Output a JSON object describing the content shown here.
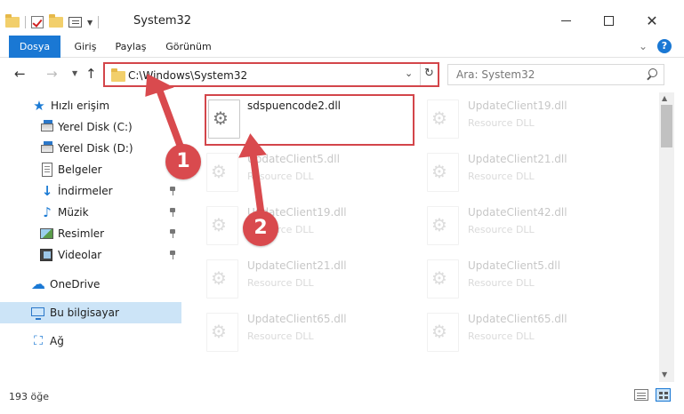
{
  "window": {
    "title": "System32"
  },
  "ribbon": {
    "tabs": [
      "Dosya",
      "Giriş",
      "Paylaş",
      "Görünüm"
    ],
    "help": "?"
  },
  "address": {
    "path": "C:\\Windows\\System32"
  },
  "search": {
    "placeholder": "Ara: System32"
  },
  "sidebar": {
    "items": [
      {
        "label": "Hızlı erişim",
        "icon": "quick-access-star-icon"
      },
      {
        "label": "Yerel Disk (C:)",
        "icon": "drive-icon"
      },
      {
        "label": "Yerel Disk (D:)",
        "icon": "drive-icon"
      },
      {
        "label": "Belgeler",
        "icon": "documents-icon",
        "pinned": true
      },
      {
        "label": "İndirmeler",
        "icon": "downloads-icon",
        "pinned": true
      },
      {
        "label": "Müzik",
        "icon": "music-icon",
        "pinned": true
      },
      {
        "label": "Resimler",
        "icon": "pictures-icon",
        "pinned": true
      },
      {
        "label": "Videolar",
        "icon": "videos-icon",
        "pinned": true
      },
      {
        "label": "OneDrive",
        "icon": "onedrive-icon"
      },
      {
        "label": "Bu bilgisayar",
        "icon": "this-pc-icon",
        "selected": true
      },
      {
        "label": "Ağ",
        "icon": "network-icon"
      }
    ]
  },
  "files": [
    {
      "name": "sdspuencode2.dll",
      "type": "",
      "highlighted": true
    },
    {
      "name": "UpdateClient19.dll",
      "type": "Resource DLL"
    },
    {
      "name": "UpdateClient5.dll",
      "type": "Resource DLL"
    },
    {
      "name": "UpdateClient21.dll",
      "type": "Resource DLL"
    },
    {
      "name": "UpdateClient19.dll",
      "type": "Resource DLL"
    },
    {
      "name": "UpdateClient42.dll",
      "type": "Resource DLL"
    },
    {
      "name": "UpdateClient21.dll",
      "type": "Resource DLL"
    },
    {
      "name": "UpdateClient5.dll",
      "type": "Resource DLL"
    },
    {
      "name": "UpdateClient65.dll",
      "type": "Resource DLL"
    },
    {
      "name": "UpdateClient65.dll",
      "type": "Resource DLL"
    }
  ],
  "status": {
    "item_count": "193 öğe"
  },
  "annotations": {
    "step1": "1",
    "step2": "2",
    "color": "#d94a4e"
  }
}
